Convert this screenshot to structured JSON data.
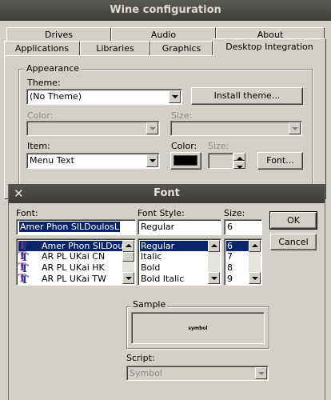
{
  "window": {
    "title": "Wine configuration"
  },
  "tabs_back": [
    "Drives",
    "Audio",
    "About"
  ],
  "tabs_front": [
    "Applications",
    "Libraries",
    "Graphics",
    "Desktop Integration"
  ],
  "appearance": {
    "group_label": "Appearance",
    "theme_label": "Theme:",
    "theme_value": "(No Theme)",
    "install_theme_label": "Install theme...",
    "color_label_top": "Color:",
    "size_label_top": "Size:",
    "item_label": "Item:",
    "item_value": "Menu Text",
    "color_label": "Color:",
    "item_color": "#000000",
    "size_label": "Size:",
    "font_button_label": "Font..."
  },
  "font_dialog": {
    "title": "Font",
    "close_glyph": "✕",
    "font_label": "Font:",
    "font_value": "Amer Phon SILDoulosL",
    "fonts": [
      "Amer Phon SILDoulosL",
      "AR PL UKai CN",
      "AR PL UKai HK",
      "AR PL UKai TW"
    ],
    "font_icon_glyph": "T",
    "style_label": "Font Style:",
    "style_value": "Regular",
    "styles": [
      "Regular",
      "Italic",
      "Bold",
      "Bold Italic"
    ],
    "size_label": "Size:",
    "size_value": "6",
    "sizes": [
      "6",
      "7",
      "8",
      "9"
    ],
    "ok_label": "OK",
    "cancel_label": "Cancel",
    "sample_label": "Sample",
    "sample_text": "symbol",
    "script_label": "Script:",
    "script_value": "Symbol"
  },
  "colors": {
    "selection": "#0a246a",
    "dialog_bg": "#d4d0c8",
    "titlebar": "#3c3b37"
  }
}
